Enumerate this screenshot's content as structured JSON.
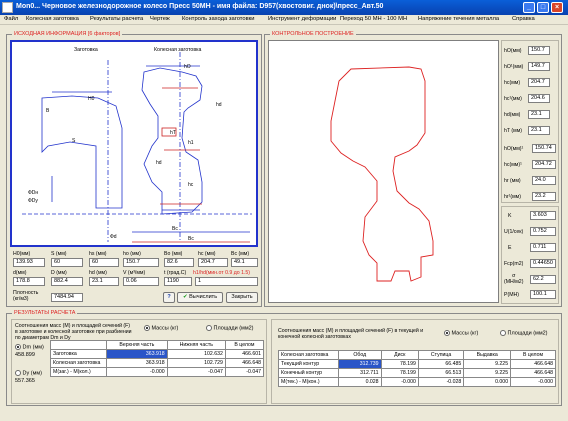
{
  "window": {
    "title": "Mon0...     Черновое  железнодорожное колесо    Пресс 50МН -     имя файла: D957(хвостовиг. днок)\\пресс_Авт.50"
  },
  "menu": [
    "Файл",
    "Колесная заготовка",
    "Результаты расчета",
    "Чертеж",
    "Контроль захода заготовки",
    "Инструмент деформации",
    "Переход 50 MH - 100 MH",
    "Напряжение течения металла",
    "Справка"
  ],
  "left_panel": {
    "title": "ИСХОДНАЯ ИНФОРМАЦИЯ [6 факторов]",
    "drawing": {
      "label_blank": "Заготовка",
      "label_wheel": "Колесная заготовка",
      "dims": [
        "H0",
        "hO",
        "B",
        "S",
        "hd",
        "hT",
        "h1",
        "hd",
        "hc",
        "ФDн",
        "ФDу",
        "Фd",
        "Bc",
        "Bc"
      ]
    },
    "fields": {
      "row1": {
        "labels": [
          "H0(мм)",
          "S (мм)",
          "hs (мм)",
          "ho (мм)",
          "Bo (мм)",
          "hc (мм)",
          "Bc (мм)"
        ],
        "values": [
          "139.93",
          "60",
          "60",
          "150.7",
          "82.6",
          "204.7",
          "49.1"
        ]
      },
      "row2": {
        "labels": [
          "d(мм)",
          "D (мм)",
          "hd (мм)",
          "V (м³/мм)",
          "t (град.C)"
        ],
        "values": [
          "178.8",
          "882.4",
          "23.1",
          "0.06",
          "1190"
        ],
        "extra_label": "h1/hd(мин.от 0.9 до 1.5)",
        "extra_value": "1"
      },
      "density_label": "Плотность\n(кг/м3)",
      "density_value": "7484.94"
    },
    "help": "?",
    "compute": "Вычислить",
    "close": "Закрыть"
  },
  "right_panel": {
    "title": "КОНТРОЛЬНОЕ ПОСТРОЕНИЕ",
    "params": [
      {
        "label": "hO(мм)",
        "value": "150.7"
      },
      {
        "label": "hO¹(мм)",
        "value": "149.7"
      },
      {
        "label": "hc(мм)",
        "value": "204.7"
      },
      {
        "label": "hc¹(мм)",
        "value": "204.6"
      },
      {
        "label": "hd(мм)",
        "value": "23.1"
      },
      {
        "label": "hT (мм)",
        "value": "23.1"
      },
      {
        "label": "hO(мм)¹",
        "value": "150.74"
      },
      {
        "label": "hc(мм)¹",
        "value": "204.72"
      },
      {
        "label": "hr (мм)",
        "value": "24.0"
      },
      {
        "label": "hr¹(мм)",
        "value": "23.2"
      }
    ],
    "params2": [
      {
        "label": "K",
        "value": "3.603"
      },
      {
        "label": "U(1/сек)",
        "value": "0.752"
      },
      {
        "label": "E",
        "value": "0.711"
      },
      {
        "label": "Fcp(m2)",
        "value": "0.44650"
      },
      {
        "label": "σ\n(MH/м2)",
        "value": "62.2"
      },
      {
        "label": "P(MH)",
        "value": "100.1"
      }
    ]
  },
  "results": {
    "title": "РЕЗУЛЬТАТЫ РАСЧЕТА",
    "left": {
      "caption": "Соотношения масс (M) и площадей сечений (F) в заготовке и колесной заготовке при разбиении по диаметрам Dm и Dy",
      "radio_mass": "Массы (кг)",
      "radio_area": "Площади (мм2)",
      "dm_label": "Dm (мм)",
      "dm_value": "458.899",
      "dy_label": "Dy (мм)",
      "dy_value": "557.365",
      "headers": [
        "",
        "Верхняя часть",
        "Нижняя часть",
        "В целом"
      ],
      "rows": [
        [
          "Заготовка",
          "363.918",
          "102.632",
          "466.601"
        ],
        [
          "Колесная заготовка",
          "363.918",
          "102.729",
          "466.648"
        ],
        [
          "М(заг.) - М(кол.)",
          "-0.000",
          "-0.047",
          "-0.047"
        ]
      ]
    },
    "right": {
      "caption": "Соотношения масс (M) и площадей сечений (F) в текущей и конечной колесной заготовках",
      "radio_mass": "Массы (кг)",
      "radio_area": "Площади (мм2)",
      "headers": [
        "Колесная заготовка",
        "Обод",
        "Диск",
        "Ступица",
        "Выдавка",
        "В целом"
      ],
      "rows": [
        [
          "Текущий контур",
          "312.739",
          "78.199",
          "66.485",
          "9.225",
          "466.648"
        ],
        [
          "Конечный контур",
          "312.711",
          "78.199",
          "66.513",
          "9.225",
          "466.648"
        ],
        [
          "M(тек.) - M(кон.)",
          "0.028",
          "-0.000",
          "-0.028",
          "0.000",
          "-0.000"
        ]
      ]
    }
  },
  "colors": {
    "accent": "#d22",
    "title_bar": "#0a5fd8",
    "selected_cell": "#2a55c8"
  }
}
